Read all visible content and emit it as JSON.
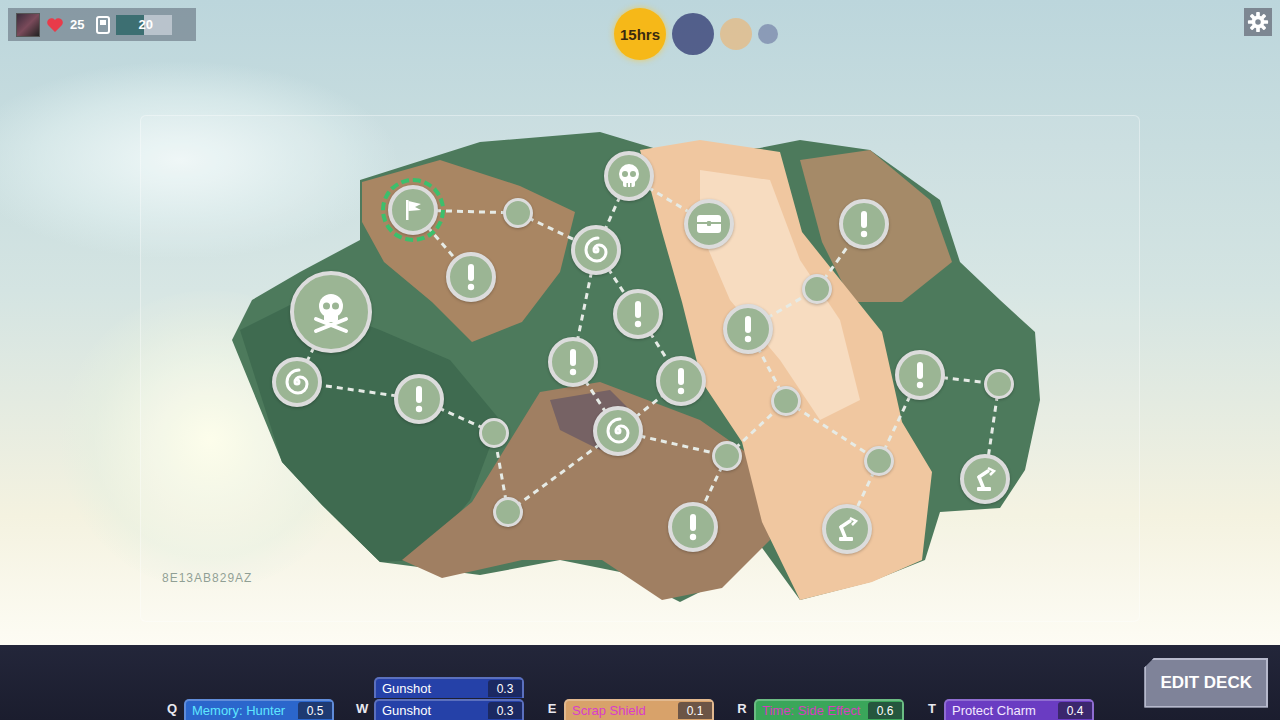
{
  "hud": {
    "health": "25",
    "deck_count": "20",
    "deck_level": 0.5
  },
  "time": {
    "label": "15hrs",
    "phases": [
      {
        "selected": true,
        "color": "#f6b818"
      },
      {
        "selected": false,
        "color": "#3f4a7c"
      },
      {
        "selected": false,
        "color": "#e2bd8c"
      },
      {
        "selected": false,
        "color": "#8190b0"
      }
    ]
  },
  "map": {
    "seed": "8E13AB829AZ",
    "nodes": [
      {
        "kind": "start",
        "current": true
      },
      {
        "kind": "empty",
        "current": false
      },
      {
        "kind": "event",
        "current": false
      },
      {
        "kind": "elite",
        "current": false
      },
      {
        "kind": "portal",
        "current": false
      },
      {
        "kind": "chest",
        "current": false
      },
      {
        "kind": "event",
        "current": false
      },
      {
        "kind": "event",
        "current": false
      },
      {
        "kind": "boss",
        "current": false
      },
      {
        "kind": "portal",
        "current": false
      },
      {
        "kind": "event",
        "current": false
      },
      {
        "kind": "empty",
        "current": false
      },
      {
        "kind": "empty",
        "current": false
      },
      {
        "kind": "portal",
        "current": false
      },
      {
        "kind": "event",
        "current": false
      },
      {
        "kind": "empty",
        "current": false
      },
      {
        "kind": "event",
        "current": false
      },
      {
        "kind": "event",
        "current": false
      },
      {
        "kind": "empty",
        "current": false
      },
      {
        "kind": "event",
        "current": false
      },
      {
        "kind": "empty",
        "current": false
      },
      {
        "kind": "event",
        "current": false
      },
      {
        "kind": "empty",
        "current": false
      },
      {
        "kind": "empty",
        "current": false
      },
      {
        "kind": "shop",
        "current": false
      },
      {
        "kind": "shop",
        "current": false
      }
    ],
    "links": [
      [
        0,
        1
      ],
      [
        0,
        2
      ],
      [
        1,
        4
      ],
      [
        3,
        4
      ],
      [
        3,
        5
      ],
      [
        4,
        6
      ],
      [
        4,
        7
      ],
      [
        7,
        13
      ],
      [
        6,
        14
      ],
      [
        13,
        14
      ],
      [
        13,
        15
      ],
      [
        13,
        12
      ],
      [
        12,
        11
      ],
      [
        11,
        10
      ],
      [
        10,
        9
      ],
      [
        9,
        8
      ],
      [
        15,
        16
      ],
      [
        15,
        20
      ],
      [
        20,
        19
      ],
      [
        19,
        18
      ],
      [
        18,
        17
      ],
      [
        20,
        23
      ],
      [
        23,
        24
      ],
      [
        23,
        21
      ],
      [
        21,
        22
      ],
      [
        22,
        25
      ]
    ]
  },
  "skills": [
    {
      "key": "Q",
      "cards": [
        {
          "name": "Memory: Hunter",
          "cost": "0.5",
          "color": "#2b66cc",
          "text_color": "#5fe6ff"
        }
      ]
    },
    {
      "key": "W",
      "cards": [
        {
          "name": "Gunshot",
          "cost": "0.3",
          "color": "#2541a8",
          "text_color": "#ffffff"
        },
        {
          "name": "Gunshot",
          "cost": "0.3",
          "color": "#2541a8",
          "text_color": "#ffffff"
        }
      ]
    },
    {
      "key": "E",
      "cards": [
        {
          "name": "Scrap Shield",
          "cost": "0.1",
          "color": "#d8a26a",
          "text_color": "#d83ccc"
        }
      ]
    },
    {
      "key": "R",
      "cards": [
        {
          "name": "Time: Side Effect",
          "cost": "0.6",
          "color": "#3aa65a",
          "text_color": "#d83cc0"
        }
      ]
    },
    {
      "key": "T",
      "cards": [
        {
          "name": "Protect Charm",
          "cost": "0.4",
          "color": "#6a3cc2",
          "text_color": "#f2e8ff"
        }
      ]
    }
  ],
  "buttons": [
    "EDIT DECK"
  ]
}
